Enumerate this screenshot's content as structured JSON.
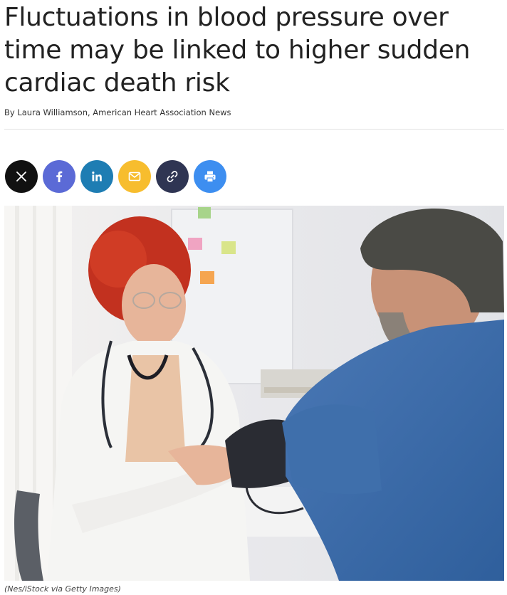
{
  "article": {
    "headline": "Fluctuations in blood pressure over time may be linked to higher sudden cardiac death risk",
    "byline": "By Laura Williamson, American Heart Association News",
    "image_alt": "Doctor measuring a patient's blood pressure",
    "image_caption": "(Nes/iStock via Getty Images)"
  },
  "share": {
    "buttons": [
      {
        "name": "x",
        "icon": "x-logo-icon",
        "color": "#111111"
      },
      {
        "name": "facebook",
        "icon": "facebook-icon",
        "color": "#5b6ad6"
      },
      {
        "name": "linkedin",
        "icon": "linkedin-icon",
        "color": "#1e7db3"
      },
      {
        "name": "email",
        "icon": "envelope-icon",
        "color": "#f7bd2e"
      },
      {
        "name": "copy-link",
        "icon": "link-icon",
        "color": "#2f3553"
      },
      {
        "name": "print",
        "icon": "printer-icon",
        "color": "#3d8ef0"
      }
    ]
  }
}
